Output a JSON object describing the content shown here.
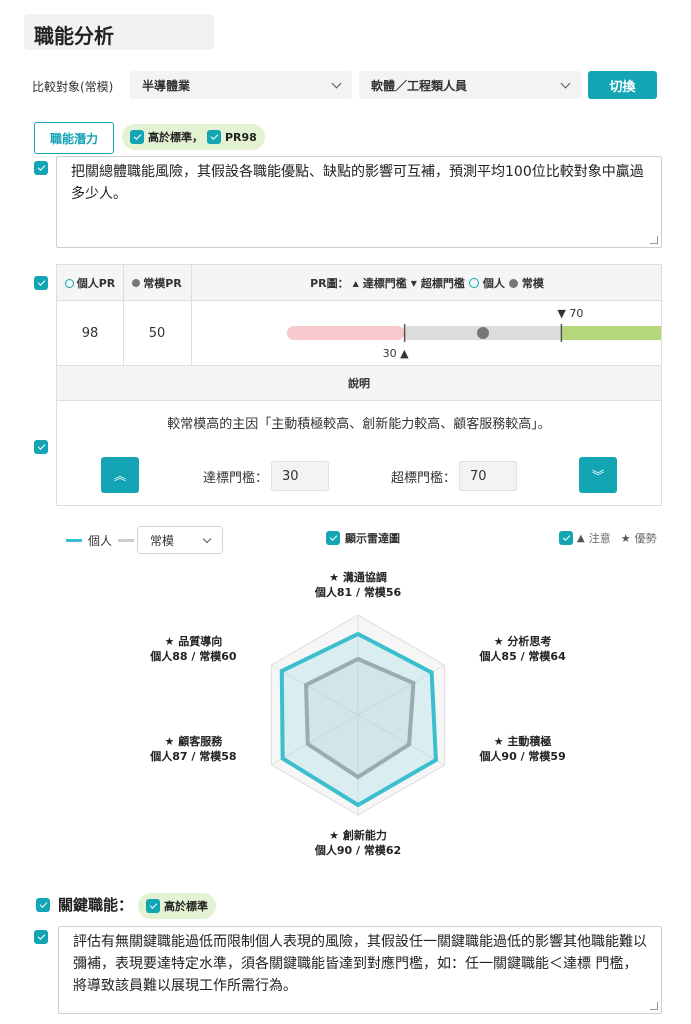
{
  "title": "職能分析",
  "compare": {
    "label": "比較對象(常模)",
    "industry": "半導體業",
    "job": "軟體／工程類人員",
    "switch_label": "切換"
  },
  "potential": {
    "tab_label": "職能潛力",
    "badge_text": "高於標準，",
    "badge_pr": "PR98",
    "description": "把關總體職能風險，其假設各職能優點、缺點的影響可互補，預測平均100位比較對象中贏過多少人。"
  },
  "pr_table": {
    "col_personal": "個人PR",
    "col_norm": "常模PR",
    "legend_prefix": "PR圖：",
    "legend_reach": "達標門檻",
    "legend_exceed": "超標門檻",
    "legend_personal": "個人",
    "legend_norm": "常模",
    "personal_pr": "98",
    "norm_pr": "50",
    "reach_threshold": 30,
    "exceed_threshold": 70,
    "reach_label": "30",
    "exceed_label": "70",
    "desc_header": "說明",
    "desc_text": "較常模高的主因「主動積極較高、創新能力較高、顧客服務較高」。",
    "reach_input_label": "達標門檻：",
    "reach_input_value": "30",
    "exceed_input_label": "超標門檻：",
    "exceed_input_value": "70"
  },
  "radar_controls": {
    "legend_personal": "個人",
    "norm_select": "常模",
    "show_radar": "顯示雷達圖",
    "attention": "注意",
    "advantage": "優勢"
  },
  "chart_data": {
    "type": "radar",
    "categories": [
      "溝通協調",
      "分析思考",
      "主動積極",
      "創新能力",
      "顧客服務",
      "品質導向"
    ],
    "series": [
      {
        "name": "個人",
        "values": [
          81,
          85,
          90,
          90,
          87,
          88
        ]
      },
      {
        "name": "常模",
        "values": [
          56,
          64,
          59,
          62,
          58,
          60
        ]
      }
    ],
    "labels": [
      {
        "title": "★ 溝通協調",
        "value": "個人81 / 常模56"
      },
      {
        "title": "★ 分析思考",
        "value": "個人85 / 常模64"
      },
      {
        "title": "★ 主動積極",
        "value": "個人90 / 常模59"
      },
      {
        "title": "★ 創新能力",
        "value": "個人90 / 常模62"
      },
      {
        "title": "★ 顧客服務",
        "value": "個人87 / 常模58"
      },
      {
        "title": "★ 品質導向",
        "value": "個人88 / 常模60"
      }
    ],
    "range": [
      0,
      100
    ],
    "colors": {
      "personal": "#3bbfce",
      "norm": "#aaaaaa"
    }
  },
  "key": {
    "label": "關鍵職能：",
    "badge_text": "高於標準",
    "description": "評估有無關鍵職能過低而限制個人表現的風險，其假設任一關鍵職能過低的影響其他職能難以彌補，表現要達特定水準，須各關鍵職能皆達到對應門檻，如：任一關鍵職能＜達標 門檻，將導致該員難以展現工作所需行為。"
  }
}
